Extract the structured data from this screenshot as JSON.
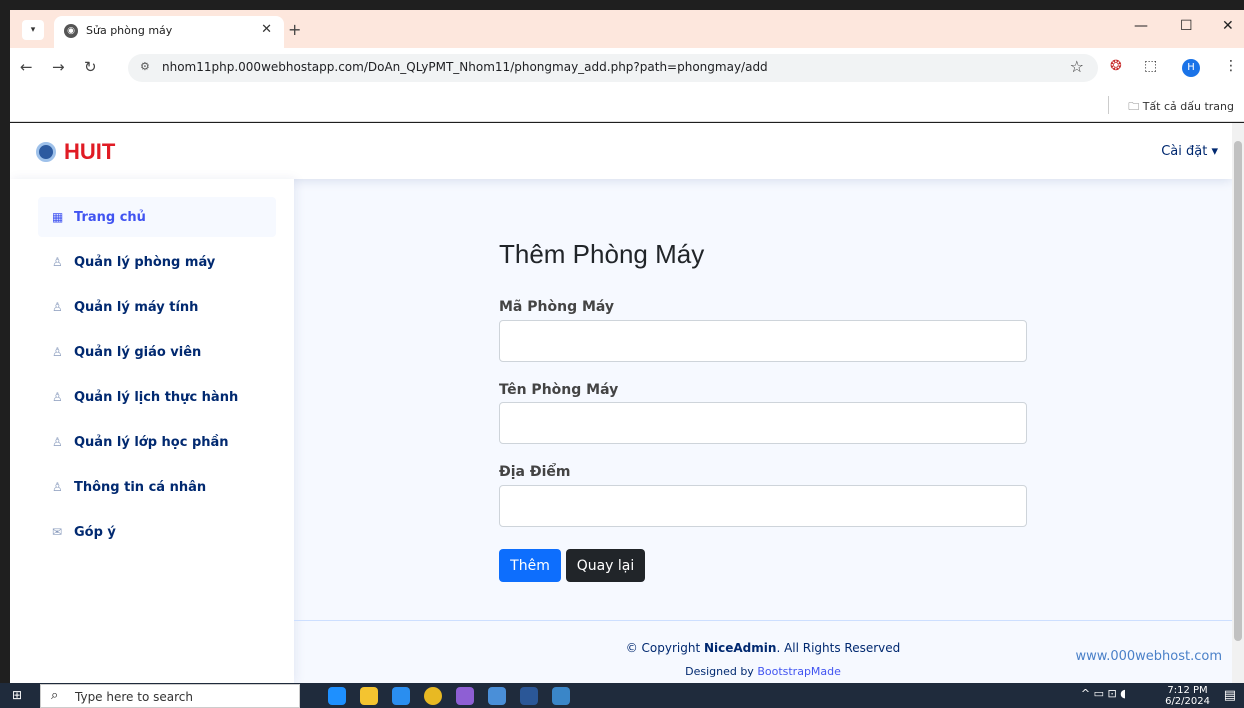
{
  "browser": {
    "tab_title": "Sửa phòng máy",
    "url": "nhom11php.000webhostapp.com/DoAn_QLyPMT_Nhom11/phongmay_add.php?path=phongmay/add",
    "bookmarks_all": "Tất cả dấu trang",
    "profile_letter": "H"
  },
  "header": {
    "logo_text": "HUIT",
    "settings_label": "Cài đặt ▾"
  },
  "sidebar": {
    "items": [
      {
        "label": "Trang chủ",
        "icon": "grid-icon"
      },
      {
        "label": "Quản lý phòng máy",
        "icon": "person-icon"
      },
      {
        "label": "Quản lý máy tính",
        "icon": "person-icon"
      },
      {
        "label": "Quản lý giáo viên",
        "icon": "person-icon"
      },
      {
        "label": "Quản lý lịch thực hành",
        "icon": "person-icon"
      },
      {
        "label": "Quản lý lớp học phần",
        "icon": "person-icon"
      },
      {
        "label": "Thông tin cá nhân",
        "icon": "person-icon"
      },
      {
        "label": "Góp ý",
        "icon": "envelope-icon"
      }
    ]
  },
  "form": {
    "title": "Thêm Phòng Máy",
    "fields": [
      {
        "label": "Mã Phòng Máy",
        "value": ""
      },
      {
        "label": "Tên Phòng Máy",
        "value": ""
      },
      {
        "label": "Địa Điểm",
        "value": ""
      }
    ],
    "submit_label": "Thêm",
    "back_label": "Quay lại"
  },
  "footer": {
    "copyright_prefix": "© Copyright ",
    "brand": "NiceAdmin",
    "copyright_suffix": ". All Rights Reserved",
    "designed_prefix": "Designed by ",
    "designed_by": "BootstrapMade",
    "webhost_text": "www.000webhost.com"
  },
  "taskbar": {
    "search_placeholder": "Type here to search",
    "time": "7:12 PM",
    "date": "6/2/2024"
  },
  "colors": {
    "accent": "#4154f1",
    "primary_button": "#0d6efd",
    "dark_button": "#212529",
    "logo_red": "#e01b24"
  }
}
